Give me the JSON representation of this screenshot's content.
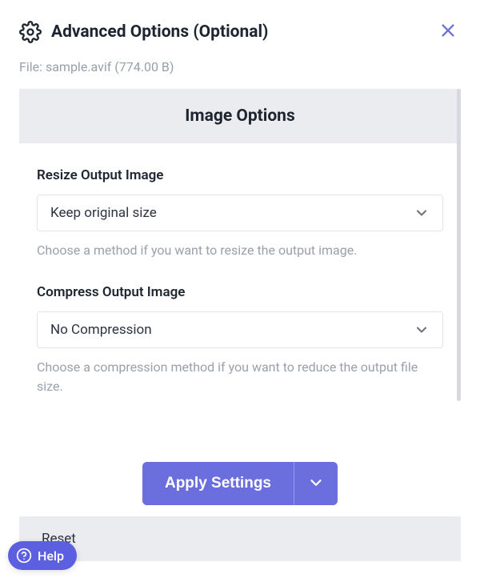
{
  "header": {
    "title": "Advanced Options (Optional)"
  },
  "file": {
    "label": "File:",
    "name": "sample.avif",
    "size": "(774.00 B)"
  },
  "panel": {
    "section_title": "Image Options",
    "resize": {
      "label": "Resize Output Image",
      "value": "Keep original size",
      "help": "Choose a method if you want to resize the output image."
    },
    "compress": {
      "label": "Compress Output Image",
      "value": "No Compression",
      "help": "Choose a compression method if you want to reduce the output file size."
    }
  },
  "actions": {
    "apply": "Apply Settings",
    "reset": "Reset"
  },
  "help": {
    "label": "Help"
  }
}
